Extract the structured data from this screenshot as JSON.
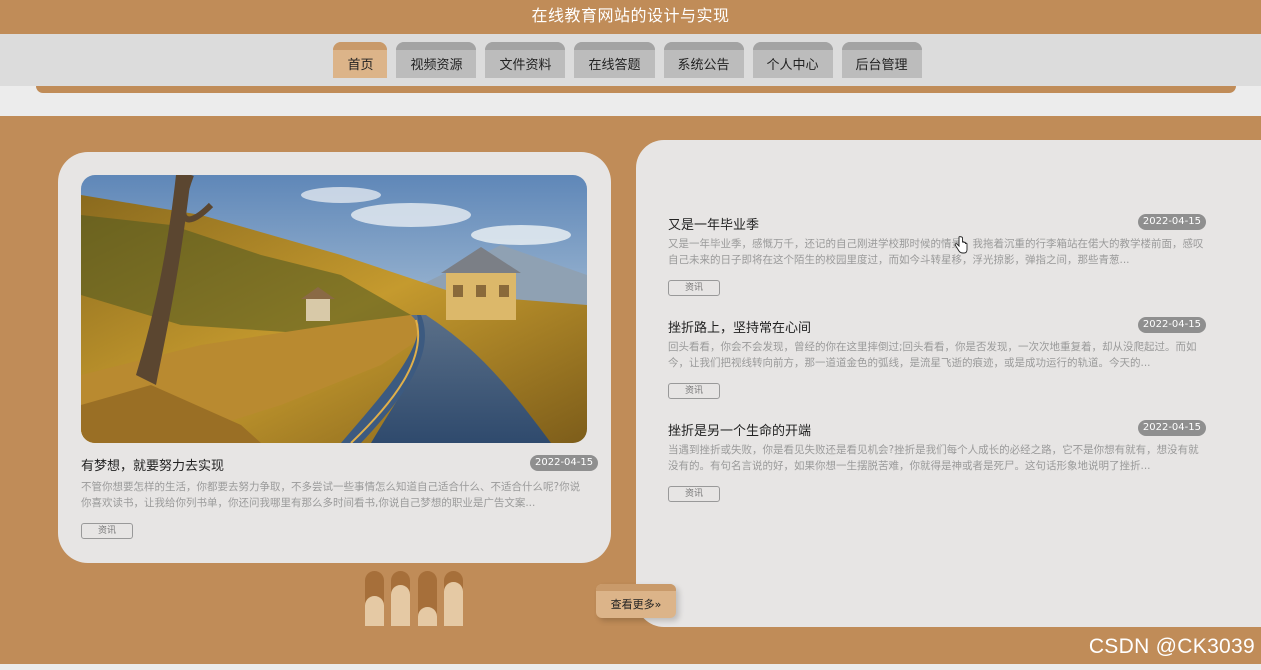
{
  "header": {
    "site_title": "在线教育网站的设计与实现"
  },
  "nav": {
    "items": [
      {
        "label": "首页",
        "active": true
      },
      {
        "label": "视频资源"
      },
      {
        "label": "文件资料"
      },
      {
        "label": "在线答题"
      },
      {
        "label": "系统公告"
      },
      {
        "label": "个人中心"
      },
      {
        "label": "后台管理"
      }
    ]
  },
  "featured": {
    "title": "有梦想，就要努力去实现",
    "date": "2022-04-15",
    "excerpt": "不管你想要怎样的生活，你都要去努力争取，不多尝试一些事情怎么知道自己适合什么、不适合什么呢?你说你喜欢读书，让我给你列书单，你还问我哪里有那么多时间看书,你说自己梦想的职业是广告文案...",
    "tag": "资讯",
    "image_icon": "landscape-photo"
  },
  "news": [
    {
      "title": "又是一年毕业季",
      "date": "2022-04-15",
      "excerpt": "又是一年毕业季，感慨万千，还记的自己刚进学校那时候的情景，我拖着沉重的行李箱站在偌大的教学楼前面，感叹自己未来的日子即将在这个陌生的校园里度过，而如今斗转星移，浮光掠影，弹指之间，那些青葱...",
      "tag": "资讯"
    },
    {
      "title": "挫折路上，坚持常在心间",
      "date": "2022-04-15",
      "excerpt": "回头看看，你会不会发现，曾经的你在这里摔倒过;回头看看，你是否发现，一次次地重复着，却从没爬起过。而如今，让我们把视线转向前方，那一道道金色的弧线，是流星飞逝的痕迹，或是成功运行的轨道。今天的...",
      "tag": "资讯"
    },
    {
      "title": "挫折是另一个生命的开端",
      "date": "2022-04-15",
      "excerpt": "当遇到挫折或失败，你是看见失败还是看见机会?挫折是我们每个人成长的必经之路，它不是你想有就有，想没有就没有的。有句名言说的好，如果你想一生摆脱苦难，你就得是神或者是死尸。这句话形象地说明了挫折...",
      "tag": "资讯"
    }
  ],
  "more_button": {
    "label": "查看更多»"
  },
  "carousel": {
    "levels": [
      0.55,
      0.75,
      0.35,
      0.8
    ]
  },
  "watermark": "CSDN @CK3039",
  "colors": {
    "primary": "#c08c58",
    "accent": "#dcb489",
    "panel": "#e7e5e4",
    "nav_bg": "#dcdcdc"
  }
}
